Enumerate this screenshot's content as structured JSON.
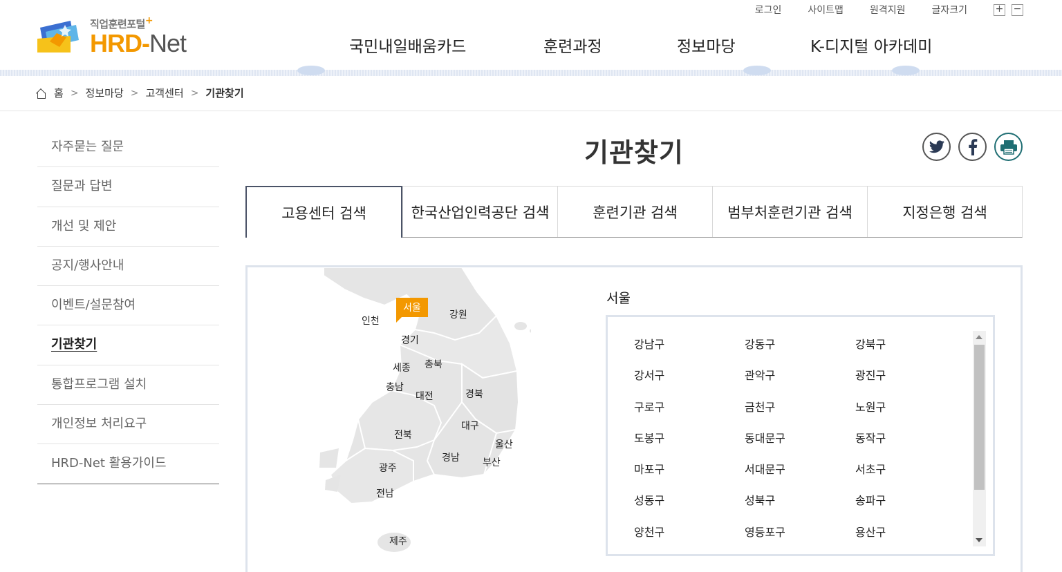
{
  "header": {
    "logo_sub": "직업훈련포털",
    "logo_plus": "+",
    "logo_hrd": "HRD",
    "logo_dash": "-",
    "logo_net": "Net",
    "util": {
      "login": "로그인",
      "sitemap": "사이트맵",
      "remote": "원격지원",
      "fontsize": "글자크기",
      "plus": "+",
      "minus": "−"
    },
    "gnb": [
      "국민내일배움카드",
      "훈련과정",
      "정보마당",
      "K-디지털 아카데미"
    ]
  },
  "breadcrumb": {
    "home": "홈",
    "items": [
      "정보마당",
      "고객센터",
      "기관찾기"
    ],
    "sep": ">"
  },
  "sidebar": {
    "items": [
      "자주묻는 질문",
      "질문과 답변",
      "개선 및 제안",
      "공지/행사안내",
      "이벤트/설문참여",
      "기관찾기",
      "통합프로그램 설치",
      "개인정보 처리요구",
      "HRD-Net 활용가이드"
    ],
    "active_index": 5
  },
  "page_title": "기관찾기",
  "sns": [
    "twitter-icon",
    "facebook-icon",
    "print-icon"
  ],
  "tabs": [
    "고용센터 검색",
    "한국산업인력공단 검색",
    "훈련기관 검색",
    "범부처훈련기관 검색",
    "지정은행 검색"
  ],
  "active_tab": 0,
  "map": {
    "selected": "서울",
    "regions": [
      "인천",
      "강원",
      "경기",
      "세종",
      "충북",
      "충남",
      "대전",
      "경북",
      "대구",
      "전북",
      "울산",
      "경남",
      "부산",
      "광주",
      "전남",
      "제주"
    ]
  },
  "colors": {
    "accent": "#f39800",
    "map_fill": "#e5e5e5",
    "border": "#dde3ec"
  },
  "region_title": "서울",
  "districts": [
    [
      "강남구",
      "강동구",
      "강북구"
    ],
    [
      "강서구",
      "관악구",
      "광진구"
    ],
    [
      "구로구",
      "금천구",
      "노원구"
    ],
    [
      "도봉구",
      "동대문구",
      "동작구"
    ],
    [
      "마포구",
      "서대문구",
      "서초구"
    ],
    [
      "성동구",
      "성북구",
      "송파구"
    ],
    [
      "양천구",
      "영등포구",
      "용산구"
    ]
  ]
}
